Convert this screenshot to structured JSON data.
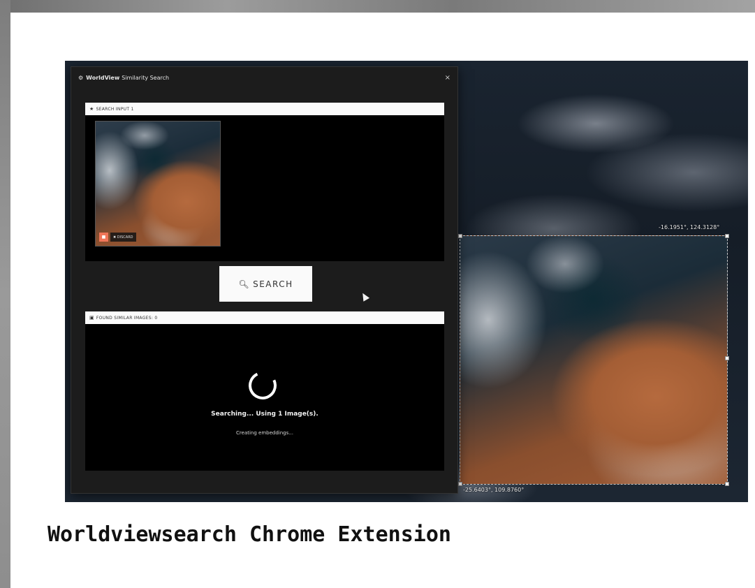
{
  "popup": {
    "brand": "WorldView",
    "title": "Similarity Search",
    "close_label": "×"
  },
  "input_panel": {
    "label": "SEARCH INPUT 1",
    "discard_label": "DISCARD"
  },
  "search_button": {
    "label": "SEARCH"
  },
  "results_panel": {
    "label": "FOUND SIMILAR IMAGES: 0",
    "status_main": "Searching... Using 1 Image(s).",
    "status_sub": "Creating embeddings..."
  },
  "map": {
    "coord_top_right": "-16.1951°, 124.3128°",
    "coord_bottom_left": "-25.6403°, 109.8760°"
  },
  "page_heading": "Worldviewsearch Chrome Extension",
  "colors": {
    "accent": "#f07558",
    "panel_bg": "#000000",
    "popup_bg": "#1c1c1c"
  }
}
